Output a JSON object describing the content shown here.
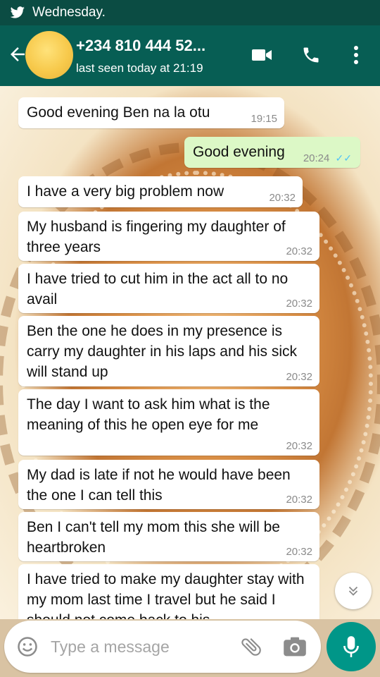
{
  "status_bar": {
    "day": "Wednesday."
  },
  "header": {
    "contact_name": "+234 810 444 52...",
    "last_seen": "last seen today at 21:19"
  },
  "messages": [
    {
      "direction": "in",
      "text": "Good evening Ben na la otu",
      "time": "19:15"
    },
    {
      "direction": "out",
      "text": "Good evening",
      "time": "20:24",
      "ticks": "✓✓"
    },
    {
      "direction": "in",
      "text": "I have a very big problem now",
      "time": "20:32"
    },
    {
      "direction": "in",
      "text": "My husband is fingering my daughter of three years",
      "time": "20:32"
    },
    {
      "direction": "in",
      "text": "I have tried to cut him in the act all to no avail",
      "time": "20:32"
    },
    {
      "direction": "in",
      "text": "Ben the one he does in my presence is carry my daughter in his laps and his sick will stand up",
      "time": "20:32"
    },
    {
      "direction": "in",
      "text": "The day I want to ask him what is the meaning of this he open eye for me",
      "time": "20:32"
    },
    {
      "direction": "in",
      "text": "My dad is late if not he would have been the one I can tell this",
      "time": "20:32"
    },
    {
      "direction": "in",
      "text": "Ben I can't tell my mom this she will be heartbroken",
      "time": "20:32"
    },
    {
      "direction": "in",
      "text": "I have tried to make my daughter stay with my mom last time I travel but he said I should not come back to his",
      "time": ""
    }
  ],
  "input": {
    "placeholder": "Type a message"
  },
  "colors": {
    "header": "#075e54",
    "status_bar": "#0b4c43",
    "outgoing_bubble": "#dcf8c6",
    "accent": "#009688"
  },
  "icons": [
    "twitter-bird-icon",
    "back-arrow-icon",
    "video-call-icon",
    "phone-icon",
    "more-vert-icon",
    "emoji-icon",
    "attach-icon",
    "camera-icon",
    "mic-icon",
    "scroll-down-icon"
  ]
}
